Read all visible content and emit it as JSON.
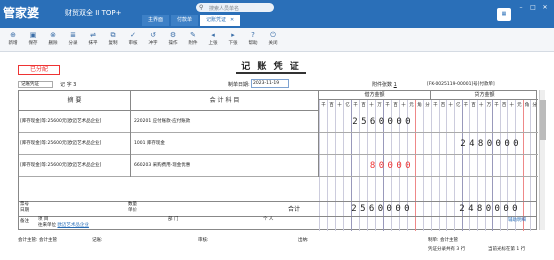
{
  "app": {
    "logo": "管家婆",
    "subtitle": "财贸双全 II TOP+",
    "search_placeholder": "搜索人员单名"
  },
  "tabs": [
    {
      "label": "主界面"
    },
    {
      "label": "付款单"
    },
    {
      "label": "记账凭证"
    }
  ],
  "toolbar": [
    {
      "label": "新增",
      "icon": "plus-icon"
    },
    {
      "label": "保存",
      "icon": "save-icon"
    },
    {
      "label": "删除",
      "icon": "delete-icon"
    },
    {
      "label": "分录",
      "icon": "list-icon"
    },
    {
      "label": "抹平",
      "icon": "flatten-icon"
    },
    {
      "label": "复制",
      "icon": "copy-icon"
    },
    {
      "label": "审核",
      "icon": "audit-icon"
    },
    {
      "label": "冲字",
      "icon": "reverse-icon"
    },
    {
      "label": "操作",
      "icon": "ops-icon"
    },
    {
      "label": "附件",
      "icon": "attach-icon"
    },
    {
      "label": "上张",
      "icon": "up-icon"
    },
    {
      "label": "下张",
      "icon": "down-icon"
    },
    {
      "label": "帮助",
      "icon": "help-icon"
    },
    {
      "label": "关闭",
      "icon": "close-icon"
    }
  ],
  "voucher": {
    "status": "已分配",
    "title": "记 账 凭 证",
    "word_select": "记账凭证",
    "word_no": "记 字 3",
    "date_label": "制单日期:",
    "date": "2023-11-19",
    "attach_label": "附件张数",
    "attach_count": "1",
    "voucher_ref": "[FK-0025119-00001]号[付款单]"
  },
  "grid": {
    "col_summary": "摘 要",
    "col_account": "会 计 科 目",
    "col_debit": "借方金额",
    "col_credit": "贷方金额",
    "digit_labels": [
      "千",
      "百",
      "十",
      "亿",
      "千",
      "百",
      "十",
      "万",
      "千",
      "百",
      "十",
      "元",
      "角",
      "分"
    ],
    "rows": [
      {
        "summary": "[库存现金]等:25600元[欧迈艺术品企业]",
        "account": "220201 应付账款-应付账款",
        "debit": "2560000",
        "credit": ""
      },
      {
        "summary": "[库存现金]等:25600元[欧迈艺术品企业]",
        "account": "1001 库存现金",
        "debit": "",
        "credit": "2480000"
      },
      {
        "summary": "[库存现金]等:25600元[欧迈艺术品企业]",
        "account": "660203 采购费用-现金优惠",
        "debit": "80000",
        "credit": ""
      }
    ],
    "total_label": "合计",
    "total_debit": "2560000",
    "total_credit": "2480000"
  },
  "footer": {
    "note_label": "备注",
    "project_label": "项 目",
    "dept_label": "部 门",
    "person_label": "个 人",
    "customer_label": "往来单位",
    "customer_value": "欧迈艺术品企业",
    "aux_btn": "辅助明细",
    "qty_label": "数量",
    "price_label": "单价",
    "ticket_label": "票号",
    "date_label": "日期"
  },
  "bottom": {
    "supervisor": "会计主管: 会计主管",
    "bookkeeper": "记账:",
    "auditor": "审核:",
    "cashier": "出纳:",
    "maker": "制单: 会计主管",
    "total_lines": "凭证分录共有 3 行",
    "current_line": "当前光标在第 1 行"
  }
}
